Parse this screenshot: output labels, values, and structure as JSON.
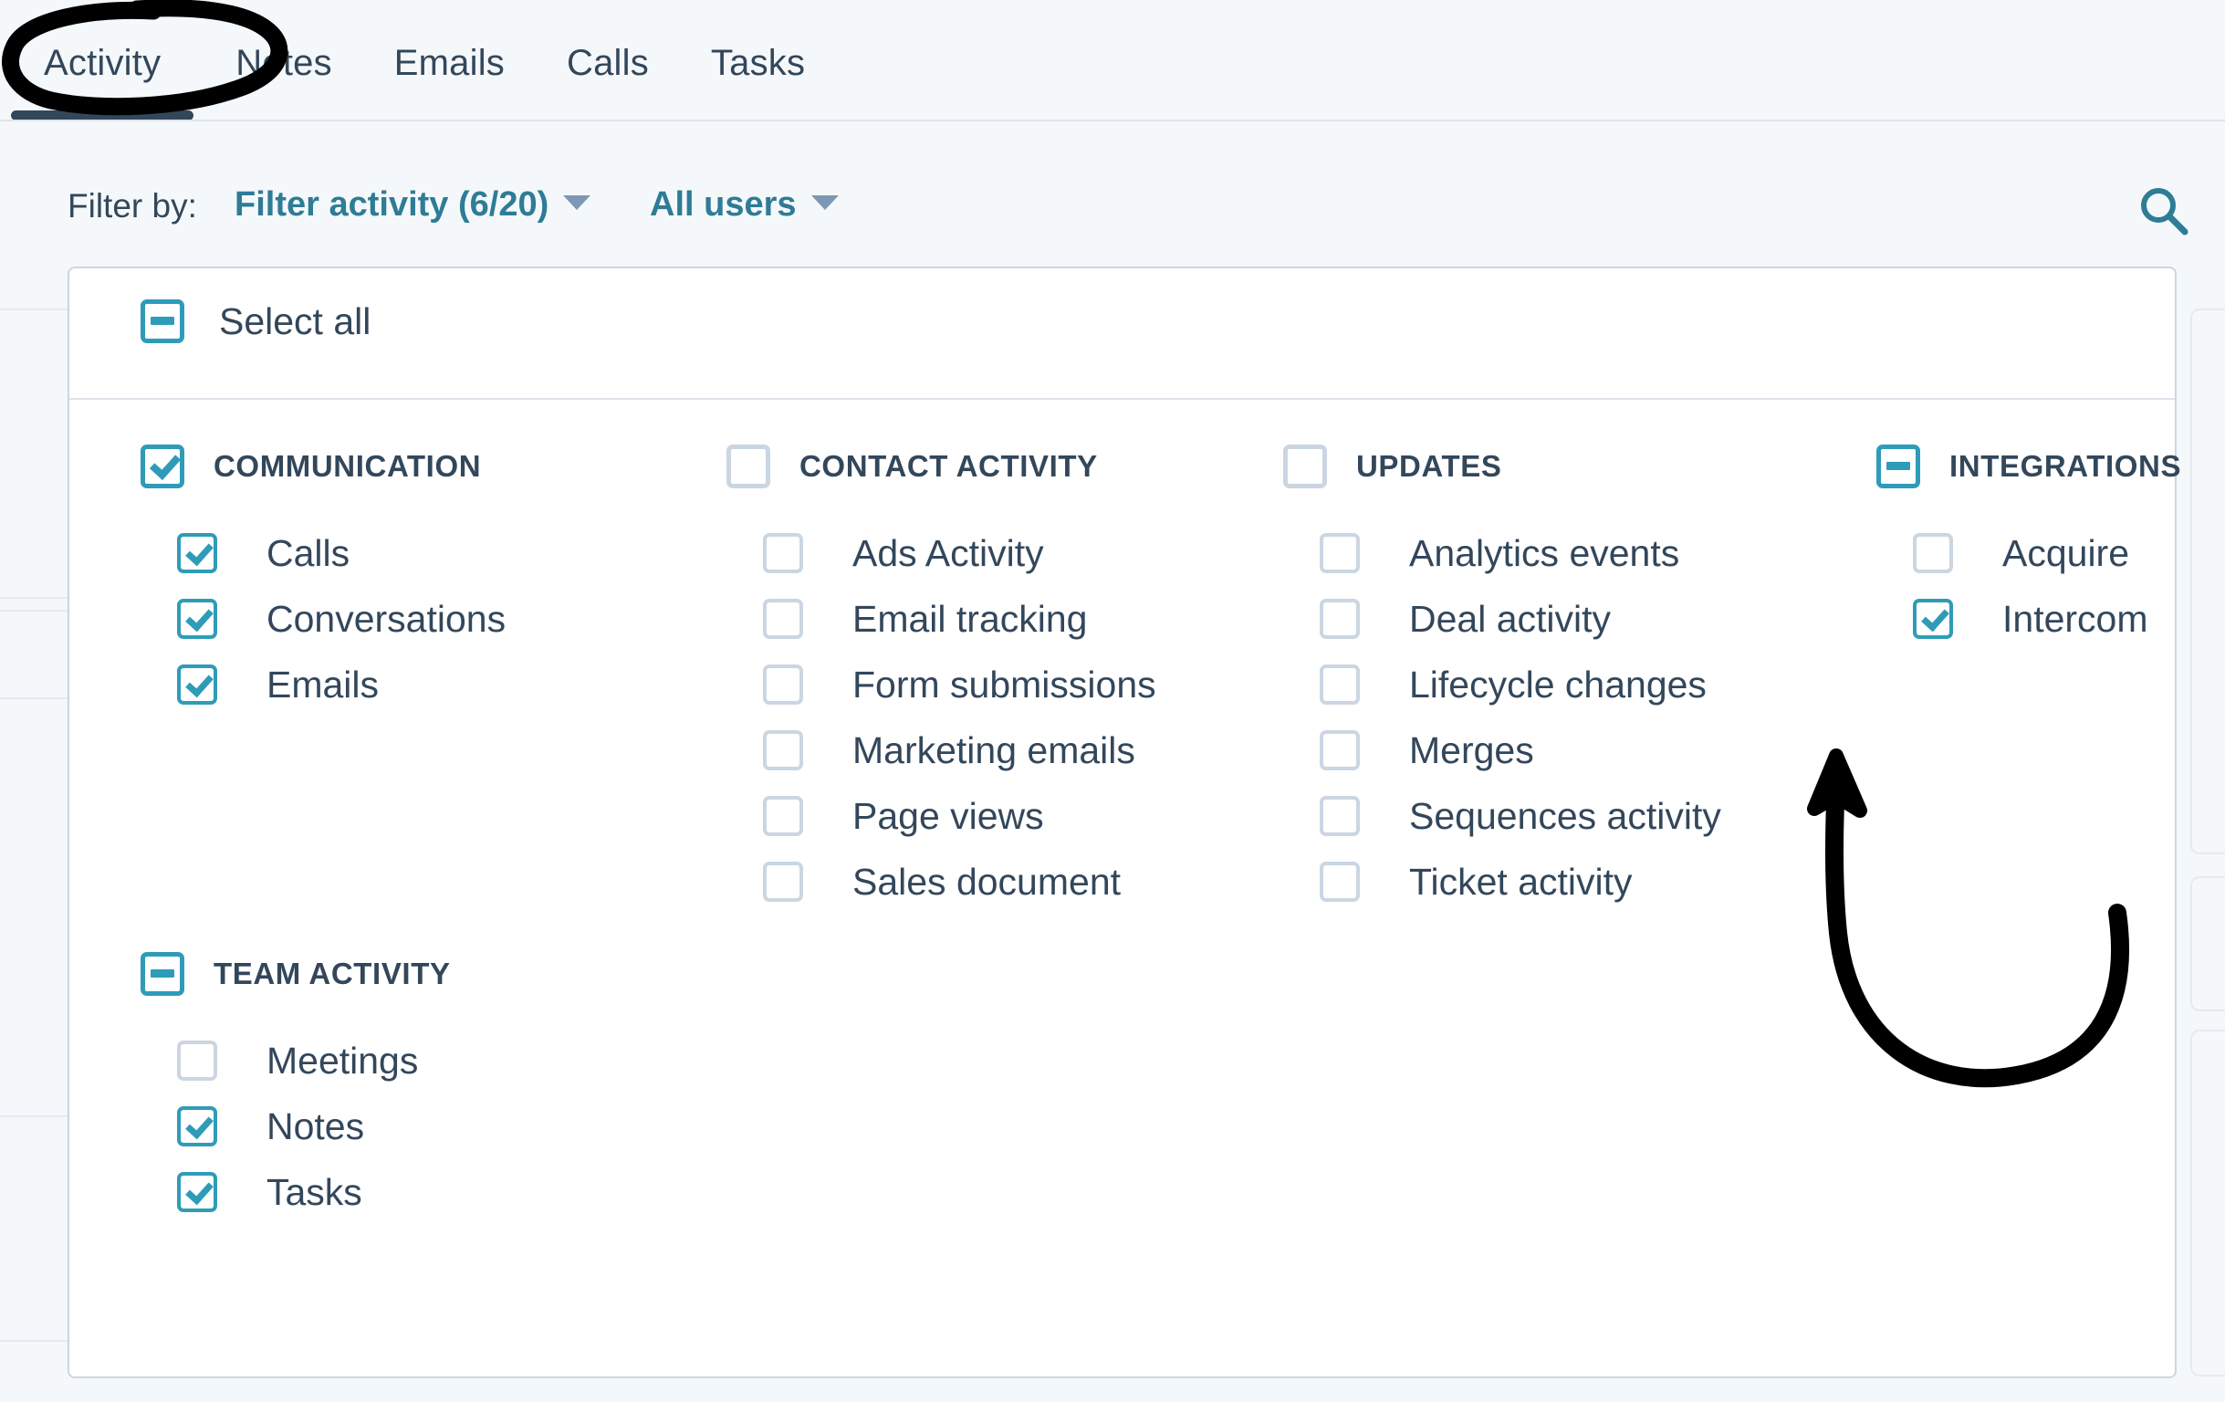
{
  "tabs": [
    {
      "label": "Activity",
      "active": true
    },
    {
      "label": "Notes",
      "active": false
    },
    {
      "label": "Emails",
      "active": false
    },
    {
      "label": "Calls",
      "active": false
    },
    {
      "label": "Tasks",
      "active": false
    }
  ],
  "filterbar": {
    "label": "Filter by:",
    "filter_activity": "Filter activity (6/20)",
    "all_users": "All users",
    "search_icon": "search-icon"
  },
  "panel": {
    "select_all": "Select all",
    "select_all_state": "indeterminate",
    "columns": [
      {
        "groups": [
          {
            "title": "COMMUNICATION",
            "state": "checked",
            "options": [
              {
                "label": "Calls",
                "state": "checked"
              },
              {
                "label": "Conversations",
                "state": "checked"
              },
              {
                "label": "Emails",
                "state": "checked"
              }
            ]
          },
          {
            "title": "TEAM ACTIVITY",
            "state": "indeterminate",
            "options": [
              {
                "label": "Meetings",
                "state": "unchecked"
              },
              {
                "label": "Notes",
                "state": "checked"
              },
              {
                "label": "Tasks",
                "state": "checked"
              }
            ]
          }
        ]
      },
      {
        "groups": [
          {
            "title": "CONTACT ACTIVITY",
            "state": "unchecked",
            "options": [
              {
                "label": "Ads Activity",
                "state": "unchecked"
              },
              {
                "label": "Email tracking",
                "state": "unchecked"
              },
              {
                "label": "Form submissions",
                "state": "unchecked"
              },
              {
                "label": "Marketing emails",
                "state": "unchecked"
              },
              {
                "label": "Page views",
                "state": "unchecked"
              },
              {
                "label": "Sales document",
                "state": "unchecked"
              }
            ]
          }
        ]
      },
      {
        "groups": [
          {
            "title": "UPDATES",
            "state": "unchecked",
            "options": [
              {
                "label": "Analytics events",
                "state": "unchecked"
              },
              {
                "label": "Deal activity",
                "state": "unchecked"
              },
              {
                "label": "Lifecycle changes",
                "state": "unchecked"
              },
              {
                "label": "Merges",
                "state": "unchecked"
              },
              {
                "label": "Sequences activity",
                "state": "unchecked"
              },
              {
                "label": "Ticket activity",
                "state": "unchecked"
              }
            ]
          }
        ]
      },
      {
        "groups": [
          {
            "title": "INTEGRATIONS",
            "state": "indeterminate",
            "options": [
              {
                "label": "Acquire",
                "state": "unchecked"
              },
              {
                "label": "Intercom",
                "state": "checked"
              }
            ]
          }
        ]
      }
    ]
  },
  "annotations": [
    {
      "type": "ellipse-circle",
      "target": "tab-activity"
    },
    {
      "type": "curved-arrow",
      "target": "checkbox-intercom"
    }
  ],
  "colors": {
    "accent_teal": "#2e9cb8",
    "link_teal": "#2e7c96",
    "text_dark": "#33475b",
    "border_light": "#cbd6e2",
    "page_bg": "#f5f8fa",
    "panel_bg": "#ffffff",
    "annotation": "#000000"
  }
}
